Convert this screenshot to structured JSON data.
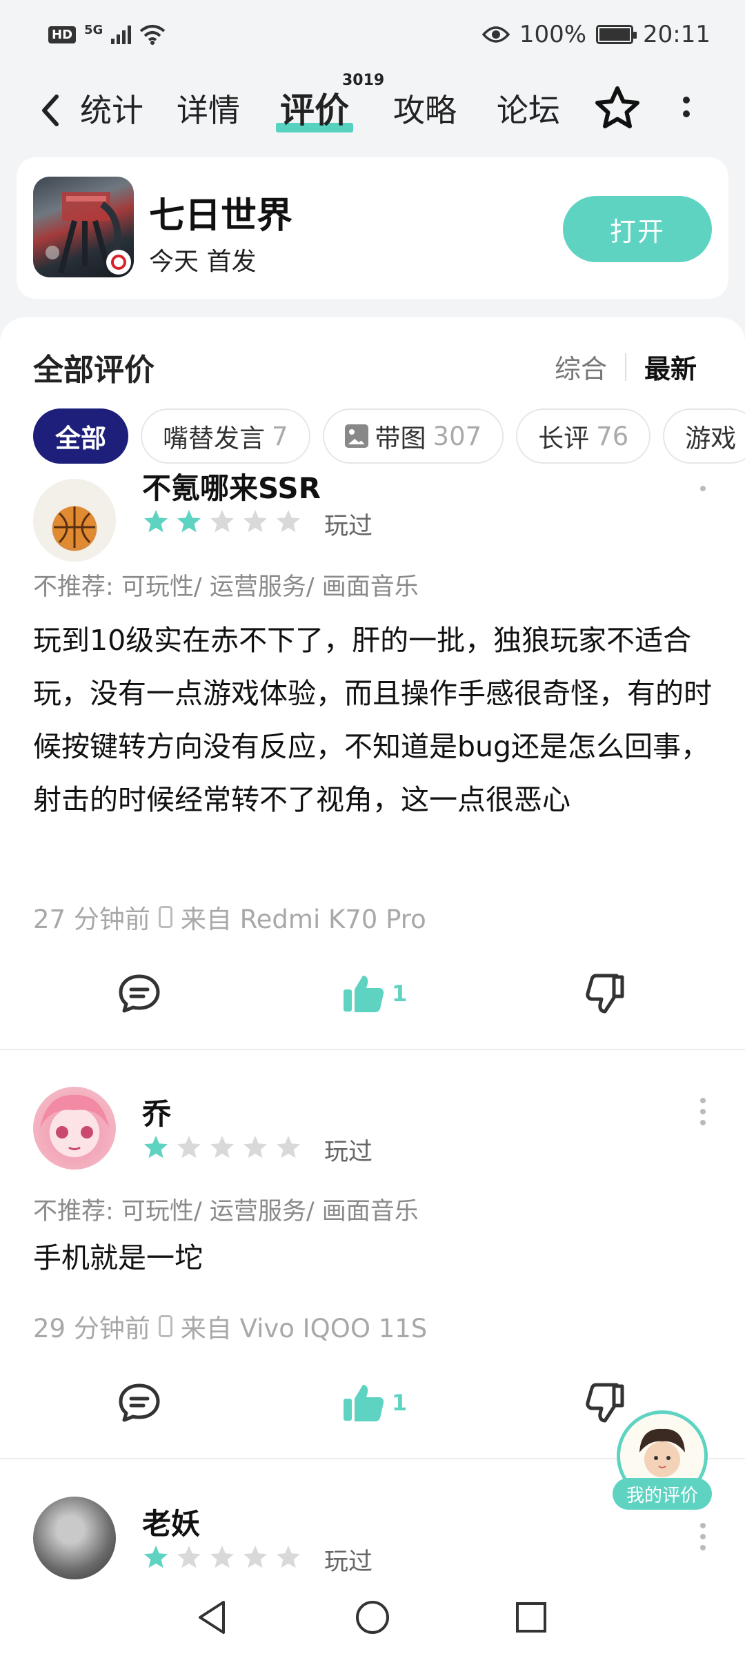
{
  "status_bar": {
    "network_badge": "HD",
    "network_type": "5G",
    "battery": "100%",
    "time": "20:11"
  },
  "nav": {
    "back_label": "统计",
    "tabs": [
      {
        "label": "详情"
      },
      {
        "label": "评价",
        "count": "3019",
        "active": true
      },
      {
        "label": "攻略"
      },
      {
        "label": "论坛"
      }
    ]
  },
  "app": {
    "title": "七日世界",
    "subtitle": "今天 首发",
    "open_label": "打开"
  },
  "reviews": {
    "heading": "全部评价",
    "sort_options": [
      "综合",
      "最新"
    ],
    "selected_sort": "最新",
    "filters": [
      {
        "label": "全部",
        "count": "",
        "active": true
      },
      {
        "label": "嘴替发言",
        "count": "7"
      },
      {
        "label": "带图",
        "count": "307"
      },
      {
        "label": "长评",
        "count": "76"
      },
      {
        "label": "游戏",
        "count": ""
      }
    ],
    "items": [
      {
        "user": "不氪哪来SSR",
        "rating": 2,
        "played": "玩过",
        "tags": "不推荐: 可玩性/ 运营服务/ 画面音乐",
        "content": "玩到10级实在赤不下了，肝的一批，独狼玩家不适合玩，没有一点游戏体验，而且操作手感很奇怪，有的时候按键转方向没有反应，不知道是bug还是怎么回事，射击的时候经常转不了视角，这一点很恶心",
        "time": "27 分钟前",
        "device": "来自 Redmi  K70 Pro",
        "likes": "1"
      },
      {
        "user": "乔",
        "rating": 1,
        "played": "玩过",
        "tags": "不推荐: 可玩性/ 运营服务/ 画面音乐",
        "content": "手机就是一坨",
        "time": "29 分钟前",
        "device": "来自 Vivo IQOO 11S",
        "likes": "1"
      },
      {
        "user": "老妖",
        "rating": 1,
        "played": "玩过"
      }
    ]
  },
  "floating": {
    "my_review_label": "我的评价"
  },
  "colors": {
    "accent": "#5fd3c2",
    "active_chip": "#1d1f7a",
    "star_empty": "#d9d9d9"
  },
  "icons": [
    "back-icon",
    "favorite-star-icon",
    "more-icon",
    "comment-icon",
    "thumbs-up-icon",
    "thumbs-down-icon",
    "nav-back-icon",
    "nav-home-icon",
    "nav-recent-icon"
  ]
}
